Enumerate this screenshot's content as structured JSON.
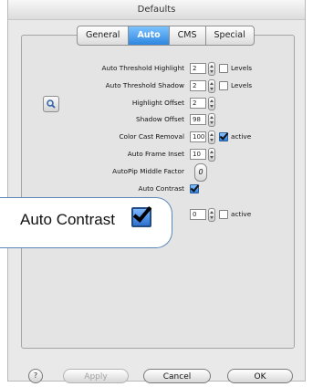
{
  "window": {
    "title": "Defaults"
  },
  "tabs": [
    {
      "label": "General"
    },
    {
      "label": "Auto"
    },
    {
      "label": "CMS"
    },
    {
      "label": "Special"
    }
  ],
  "settings": [
    {
      "label": "Auto Threshold Highlight",
      "value": "2",
      "checkbox_label": "Levels"
    },
    {
      "label": "Auto Threshold Shadow",
      "value": "2",
      "checkbox_label": "Levels"
    },
    {
      "label": "Highlight Offset",
      "value": "2"
    },
    {
      "label": "Shadow Offset",
      "value": "98"
    },
    {
      "label": "Color Cast Removal",
      "value": "100",
      "checkbox_label": "active"
    },
    {
      "label": "Auto Frame Inset",
      "value": "10"
    },
    {
      "label": "AutoPip Middle Factor",
      "value": "0"
    },
    {
      "label": "Auto Contrast"
    }
  ],
  "partial_row": {
    "value": "0",
    "checkbox_label": "active"
  },
  "magnifier": {
    "label": "Auto Contrast"
  },
  "buttons": {
    "apply": "Apply",
    "cancel": "Cancel",
    "ok": "OK"
  },
  "icons": {
    "help": "question-icon",
    "magnifier": "magnifier-icon"
  }
}
